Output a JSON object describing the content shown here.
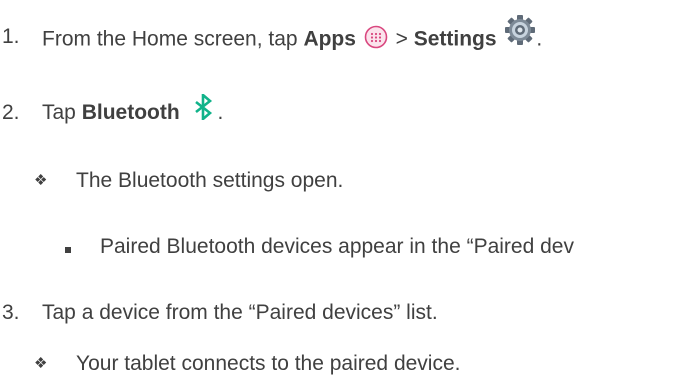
{
  "steps": [
    {
      "number": "1.",
      "prefix": "From the Home screen, tap ",
      "bold1": "Apps",
      "sep": " > ",
      "bold2": "Settings",
      "suffix": "."
    },
    {
      "number": "2.",
      "prefix": "Tap ",
      "bold1": "Bluetooth",
      "suffix": "."
    },
    {
      "number": "3.",
      "text": "Tap a device from the “Paired devices” list."
    }
  ],
  "sub_bullets": {
    "step2_result": "The Bluetooth settings open.",
    "step2_detail": "Paired Bluetooth devices appear in the “Paired dev",
    "step3_result": "Your tablet connects to the paired device."
  },
  "bullet_glyph": "❖",
  "icons": {
    "apps": "apps-grid-icon",
    "settings": "gear-icon",
    "bluetooth": "bluetooth-icon"
  },
  "colors": {
    "text": "#404040",
    "apps_icon": "#d9477f",
    "settings_icon": "#5f6b78",
    "bluetooth_icon": "#11b38a"
  }
}
